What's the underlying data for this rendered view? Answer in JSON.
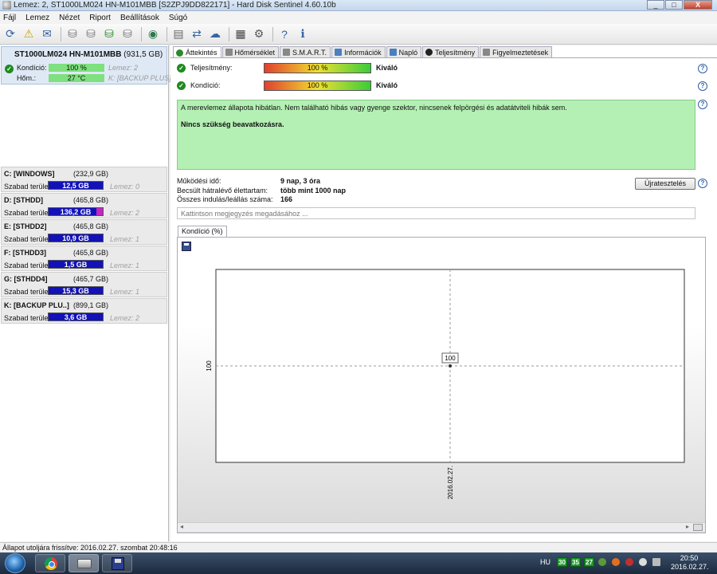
{
  "window": {
    "title": "Lemez: 2, ST1000LM024 HN-M101MBB [S2ZPJ9DD822171]  -  Hard Disk Sentinel 4.60.10b",
    "minimize": "_",
    "maximize": "□",
    "close": "X"
  },
  "menu": [
    "Fájl",
    "Lemez",
    "Nézet",
    "Riport",
    "Beállítások",
    "Súgó"
  ],
  "toolbar": {
    "icons": [
      "refresh-icon",
      "warning-icon",
      "email-icon",
      "disk-icon-1",
      "disk-icon-2",
      "disk-icon-3",
      "disk-icon-4",
      "globe-icon",
      "report-icon",
      "sync-icon",
      "share-icon",
      "chip-icon",
      "settings-icon",
      "help-icon",
      "info-icon"
    ]
  },
  "disk": {
    "name": "ST1000LM024 HN-M101MBB",
    "size": "(931,5 GB)",
    "condition_label": "Kondíció:",
    "condition_value": "100 %",
    "condition_level": 1.0,
    "temp_label": "Hőm.:",
    "temp_value": "27 °C",
    "disk_ref": "Lemez: 2",
    "volume_ref": "K: [BACKUP PLUS]"
  },
  "volumes": [
    {
      "name": "C: [WINDOWS]",
      "size": "(232,9 GB)",
      "free_label": "Szabad terület",
      "free": "12,5 GB",
      "disk": "Lemez: 0"
    },
    {
      "name": "D: [STHDD]",
      "size": "(465,8 GB)",
      "free_label": "Szabad terület",
      "free": "136,2 GB",
      "disk": "Lemez: 2"
    },
    {
      "name": "E: [STHDD2]",
      "size": "(465,8 GB)",
      "free_label": "Szabad terület",
      "free": "10,9 GB",
      "disk": "Lemez: 1"
    },
    {
      "name": "F: [STHDD3]",
      "size": "(465,8 GB)",
      "free_label": "Szabad terület",
      "free": "1,5 GB",
      "disk": "Lemez: 1"
    },
    {
      "name": "G: [STHDD4]",
      "size": "(465,7 GB)",
      "free_label": "Szabad terület",
      "free": "15,3 GB",
      "disk": "Lemez: 1"
    },
    {
      "name": "K: [BACKUP PLU..]",
      "size": "(899,1 GB)",
      "free_label": "Szabad terület",
      "free": "3,6 GB",
      "disk": "Lemez: 2"
    }
  ],
  "tabs": [
    "Áttekintés",
    "Hőmérséklet",
    "S.M.A.R.T.",
    "Információk",
    "Napló",
    "Teljesítmény",
    "Figyelmeztetések"
  ],
  "overview": {
    "performance_label": "Teljesítmény:",
    "performance_value": "100 %",
    "performance_level": 1.0,
    "performance_rating": "Kiváló",
    "health_label": "Kondíció:",
    "health_value": "100 %",
    "health_level": 1.0,
    "health_rating": "Kiváló",
    "status_text": "A merevlemez állapota hibátlan. Nem található hibás vagy gyenge szektor, nincsenek felpörgési és adatátviteli hibák sem.",
    "status_action": "Nincs szükség beavatkozásra.",
    "uptime_label": "Működési idő:",
    "uptime_value": "9 nap, 3 óra",
    "remaining_label": "Becsült hátralévő élettartam:",
    "remaining_value": "több mint 1000 nap",
    "startstop_label": "Összes indulás/leállás száma:",
    "startstop_value": "166",
    "retest_button": "Újratesztelés",
    "note_placeholder": "Kattintson megjegyzés megadásához ..."
  },
  "chart_tab": "Kondíció  (%)",
  "chart_data": {
    "type": "line",
    "x": [
      "2016.02.27."
    ],
    "series": [
      {
        "values": [
          100
        ]
      }
    ],
    "point_labels": [
      "100"
    ],
    "ytick": "100",
    "xtick": "2016.02.27.",
    "title": "",
    "xlabel": "",
    "ylabel": ""
  },
  "statusbar": "Állapot utoljára frissítve: 2016.02.27. szombat 20:48:16",
  "taskbar": {
    "lang": "HU",
    "temps": [
      "30",
      "35",
      "27"
    ],
    "time": "20:50",
    "date": "2016.02.27."
  },
  "colors": {
    "good_green": "#1f8a1f",
    "status_bg": "#b4f0b4",
    "volume_bar": "#1212b8",
    "volume_bar_accent": "#c028c0"
  }
}
